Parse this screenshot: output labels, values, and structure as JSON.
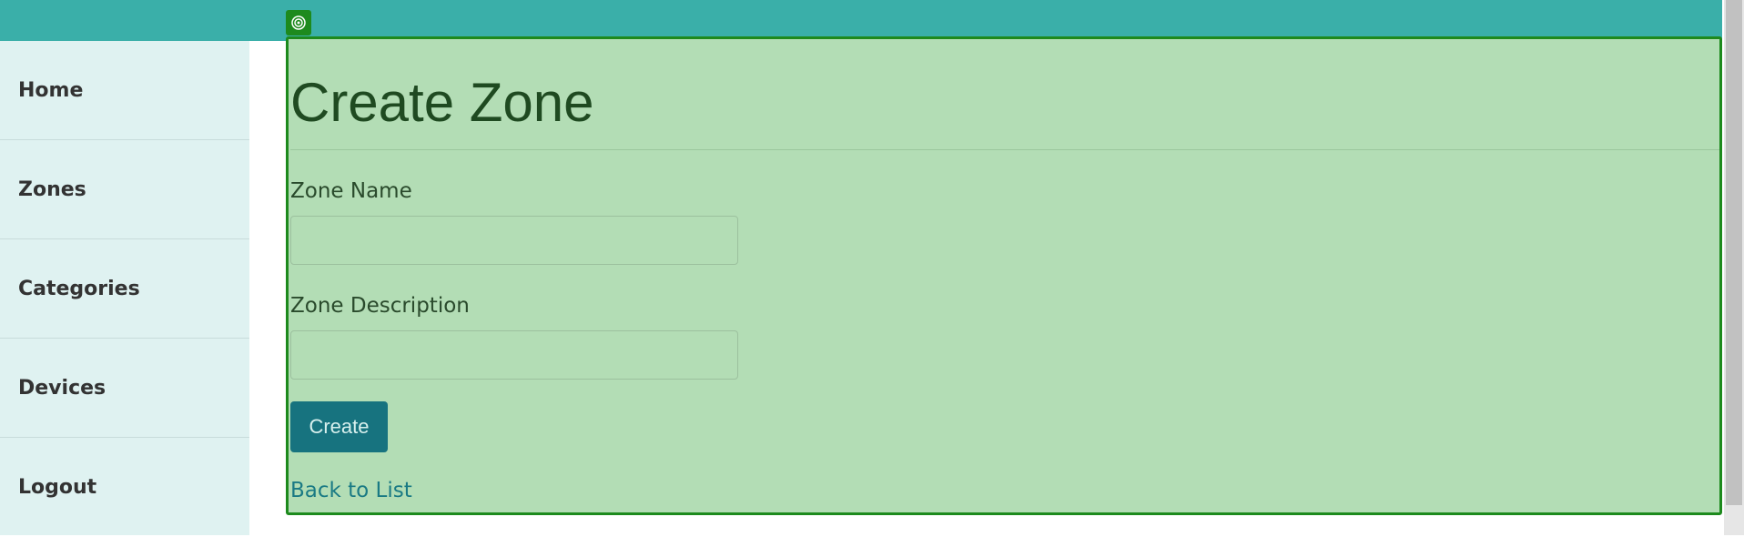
{
  "sidebar": {
    "items": [
      {
        "label": "Home"
      },
      {
        "label": "Zones"
      },
      {
        "label": "Categories"
      },
      {
        "label": "Devices"
      },
      {
        "label": "Logout"
      }
    ]
  },
  "page": {
    "title": "Create Zone"
  },
  "form": {
    "zone_name_label": "Zone Name",
    "zone_name_value": "",
    "zone_description_label": "Zone Description",
    "zone_description_value": "",
    "create_label": "Create",
    "back_label": "Back to List"
  },
  "colors": {
    "header": "#3aafa9",
    "sidebar": "#dff2f1",
    "highlight": "#b3ddb5",
    "highlight_border": "#1d8a1d",
    "button": "#17737f",
    "link": "#1a7a84"
  },
  "icons": {
    "highlight_marker": "target-icon"
  }
}
